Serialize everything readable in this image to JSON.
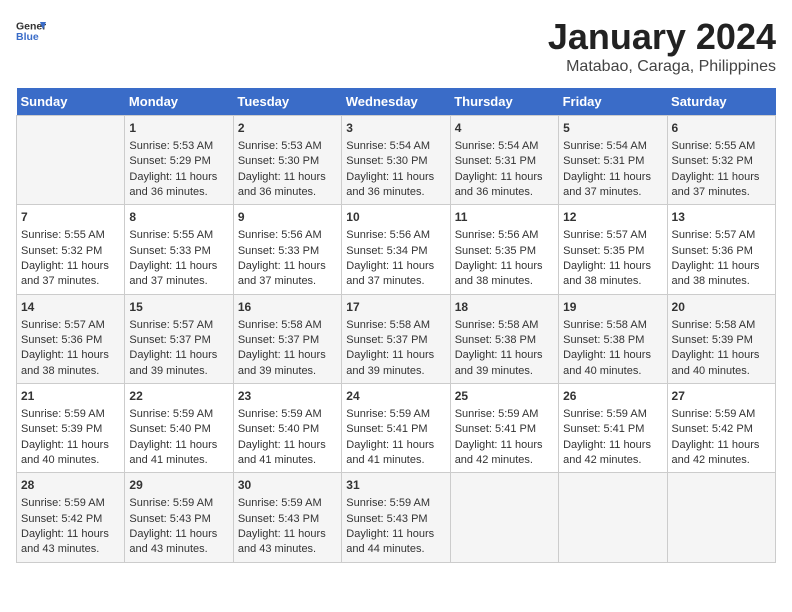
{
  "header": {
    "logo_general": "General",
    "logo_blue": "Blue",
    "title": "January 2024",
    "subtitle": "Matabao, Caraga, Philippines"
  },
  "calendar": {
    "days_of_week": [
      "Sunday",
      "Monday",
      "Tuesday",
      "Wednesday",
      "Thursday",
      "Friday",
      "Saturday"
    ],
    "weeks": [
      [
        {
          "day": "",
          "content": ""
        },
        {
          "day": "1",
          "content": "Sunrise: 5:53 AM\nSunset: 5:29 PM\nDaylight: 11 hours\nand 36 minutes."
        },
        {
          "day": "2",
          "content": "Sunrise: 5:53 AM\nSunset: 5:30 PM\nDaylight: 11 hours\nand 36 minutes."
        },
        {
          "day": "3",
          "content": "Sunrise: 5:54 AM\nSunset: 5:30 PM\nDaylight: 11 hours\nand 36 minutes."
        },
        {
          "day": "4",
          "content": "Sunrise: 5:54 AM\nSunset: 5:31 PM\nDaylight: 11 hours\nand 36 minutes."
        },
        {
          "day": "5",
          "content": "Sunrise: 5:54 AM\nSunset: 5:31 PM\nDaylight: 11 hours\nand 37 minutes."
        },
        {
          "day": "6",
          "content": "Sunrise: 5:55 AM\nSunset: 5:32 PM\nDaylight: 11 hours\nand 37 minutes."
        }
      ],
      [
        {
          "day": "7",
          "content": "Sunrise: 5:55 AM\nSunset: 5:32 PM\nDaylight: 11 hours\nand 37 minutes."
        },
        {
          "day": "8",
          "content": "Sunrise: 5:55 AM\nSunset: 5:33 PM\nDaylight: 11 hours\nand 37 minutes."
        },
        {
          "day": "9",
          "content": "Sunrise: 5:56 AM\nSunset: 5:33 PM\nDaylight: 11 hours\nand 37 minutes."
        },
        {
          "day": "10",
          "content": "Sunrise: 5:56 AM\nSunset: 5:34 PM\nDaylight: 11 hours\nand 37 minutes."
        },
        {
          "day": "11",
          "content": "Sunrise: 5:56 AM\nSunset: 5:35 PM\nDaylight: 11 hours\nand 38 minutes."
        },
        {
          "day": "12",
          "content": "Sunrise: 5:57 AM\nSunset: 5:35 PM\nDaylight: 11 hours\nand 38 minutes."
        },
        {
          "day": "13",
          "content": "Sunrise: 5:57 AM\nSunset: 5:36 PM\nDaylight: 11 hours\nand 38 minutes."
        }
      ],
      [
        {
          "day": "14",
          "content": "Sunrise: 5:57 AM\nSunset: 5:36 PM\nDaylight: 11 hours\nand 38 minutes."
        },
        {
          "day": "15",
          "content": "Sunrise: 5:57 AM\nSunset: 5:37 PM\nDaylight: 11 hours\nand 39 minutes."
        },
        {
          "day": "16",
          "content": "Sunrise: 5:58 AM\nSunset: 5:37 PM\nDaylight: 11 hours\nand 39 minutes."
        },
        {
          "day": "17",
          "content": "Sunrise: 5:58 AM\nSunset: 5:37 PM\nDaylight: 11 hours\nand 39 minutes."
        },
        {
          "day": "18",
          "content": "Sunrise: 5:58 AM\nSunset: 5:38 PM\nDaylight: 11 hours\nand 39 minutes."
        },
        {
          "day": "19",
          "content": "Sunrise: 5:58 AM\nSunset: 5:38 PM\nDaylight: 11 hours\nand 40 minutes."
        },
        {
          "day": "20",
          "content": "Sunrise: 5:58 AM\nSunset: 5:39 PM\nDaylight: 11 hours\nand 40 minutes."
        }
      ],
      [
        {
          "day": "21",
          "content": "Sunrise: 5:59 AM\nSunset: 5:39 PM\nDaylight: 11 hours\nand 40 minutes."
        },
        {
          "day": "22",
          "content": "Sunrise: 5:59 AM\nSunset: 5:40 PM\nDaylight: 11 hours\nand 41 minutes."
        },
        {
          "day": "23",
          "content": "Sunrise: 5:59 AM\nSunset: 5:40 PM\nDaylight: 11 hours\nand 41 minutes."
        },
        {
          "day": "24",
          "content": "Sunrise: 5:59 AM\nSunset: 5:41 PM\nDaylight: 11 hours\nand 41 minutes."
        },
        {
          "day": "25",
          "content": "Sunrise: 5:59 AM\nSunset: 5:41 PM\nDaylight: 11 hours\nand 42 minutes."
        },
        {
          "day": "26",
          "content": "Sunrise: 5:59 AM\nSunset: 5:41 PM\nDaylight: 11 hours\nand 42 minutes."
        },
        {
          "day": "27",
          "content": "Sunrise: 5:59 AM\nSunset: 5:42 PM\nDaylight: 11 hours\nand 42 minutes."
        }
      ],
      [
        {
          "day": "28",
          "content": "Sunrise: 5:59 AM\nSunset: 5:42 PM\nDaylight: 11 hours\nand 43 minutes."
        },
        {
          "day": "29",
          "content": "Sunrise: 5:59 AM\nSunset: 5:43 PM\nDaylight: 11 hours\nand 43 minutes."
        },
        {
          "day": "30",
          "content": "Sunrise: 5:59 AM\nSunset: 5:43 PM\nDaylight: 11 hours\nand 43 minutes."
        },
        {
          "day": "31",
          "content": "Sunrise: 5:59 AM\nSunset: 5:43 PM\nDaylight: 11 hours\nand 44 minutes."
        },
        {
          "day": "",
          "content": ""
        },
        {
          "day": "",
          "content": ""
        },
        {
          "day": "",
          "content": ""
        }
      ]
    ]
  }
}
